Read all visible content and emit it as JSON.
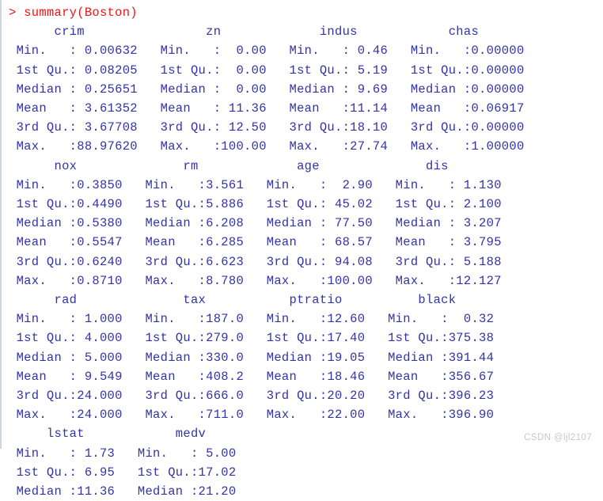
{
  "window": {
    "title": "R Console",
    "background_color": "#ffffff",
    "prompt_color": "#f01414",
    "output_color": "#3333aa",
    "watermark_color": "#c8c8c8"
  },
  "prompt": {
    "symbol": ">",
    "command": "summary(Boston)",
    "full_line": "> summary(Boston)"
  },
  "watermark": {
    "text": "CSDN @ljl2107"
  },
  "output_lines": [
    "      crim                zn             indus            chas        ",
    " Min.   : 0.00632   Min.   :  0.00   Min.   : 0.46   Min.   :0.00000  ",
    " 1st Qu.: 0.08205   1st Qu.:  0.00   1st Qu.: 5.19   1st Qu.:0.00000  ",
    " Median : 0.25651   Median :  0.00   Median : 9.69   Median :0.00000  ",
    " Mean   : 3.61352   Mean   : 11.36   Mean   :11.14   Mean   :0.06917  ",
    " 3rd Qu.: 3.67708   3rd Qu.: 12.50   3rd Qu.:18.10   3rd Qu.:0.00000  ",
    " Max.   :88.97620   Max.   :100.00   Max.   :27.74   Max.   :1.00000  ",
    "      nox              rm             age              dis        ",
    " Min.   :0.3850   Min.   :3.561   Min.   :  2.90   Min.   : 1.130  ",
    " 1st Qu.:0.4490   1st Qu.:5.886   1st Qu.: 45.02   1st Qu.: 2.100  ",
    " Median :0.5380   Median :6.208   Median : 77.50   Median : 3.207  ",
    " Mean   :0.5547   Mean   :6.285   Mean   : 68.57   Mean   : 3.795  ",
    " 3rd Qu.:0.6240   3rd Qu.:6.623   3rd Qu.: 94.08   3rd Qu.: 5.188  ",
    " Max.   :0.8710   Max.   :8.780   Max.   :100.00   Max.   :12.127  ",
    "      rad              tax           ptratio          black       ",
    " Min.   : 1.000   Min.   :187.0   Min.   :12.60   Min.   :  0.32  ",
    " 1st Qu.: 4.000   1st Qu.:279.0   1st Qu.:17.40   1st Qu.:375.38  ",
    " Median : 5.000   Median :330.0   Median :19.05   Median :391.44  ",
    " Mean   : 9.549   Mean   :408.2   Mean   :18.46   Mean   :356.67  ",
    " 3rd Qu.:24.000   3rd Qu.:666.0   3rd Qu.:20.20   3rd Qu.:396.23  ",
    " Max.   :24.000   Max.   :711.0   Max.   :22.00   Max.   :396.90  ",
    "     lstat            medv      ",
    " Min.   : 1.73   Min.   : 5.00  ",
    " 1st Qu.: 6.95   1st Qu.:17.02  ",
    " Median :11.36   Median :21.20  "
  ],
  "summary_table": {
    "type": "table",
    "function": "summary",
    "dataset": "Boston",
    "statistics": [
      "Min.",
      "1st Qu.",
      "Median",
      "Mean",
      "3rd Qu.",
      "Max."
    ],
    "variables": [
      {
        "name": "crim",
        "Min.": "0.00632",
        "1st Qu.": "0.08205",
        "Median": "0.25651",
        "Mean": "3.61352",
        "3rd Qu.": "3.67708",
        "Max.": "88.97620"
      },
      {
        "name": "zn",
        "Min.": "0.00",
        "1st Qu.": "0.00",
        "Median": "0.00",
        "Mean": "11.36",
        "3rd Qu.": "12.50",
        "Max.": "100.00"
      },
      {
        "name": "indus",
        "Min.": "0.46",
        "1st Qu.": "5.19",
        "Median": "9.69",
        "Mean": "11.14",
        "3rd Qu.": "18.10",
        "Max.": "27.74"
      },
      {
        "name": "chas",
        "Min.": "0.00000",
        "1st Qu.": "0.00000",
        "Median": "0.00000",
        "Mean": "0.06917",
        "3rd Qu.": "0.00000",
        "Max.": "1.00000"
      },
      {
        "name": "nox",
        "Min.": "0.3850",
        "1st Qu.": "0.4490",
        "Median": "0.5380",
        "Mean": "0.5547",
        "3rd Qu.": "0.6240",
        "Max.": "0.8710"
      },
      {
        "name": "rm",
        "Min.": "3.561",
        "1st Qu.": "5.886",
        "Median": "6.208",
        "Mean": "6.285",
        "3rd Qu.": "6.623",
        "Max.": "8.780"
      },
      {
        "name": "age",
        "Min.": "2.90",
        "1st Qu.": "45.02",
        "Median": "77.50",
        "Mean": "68.57",
        "3rd Qu.": "94.08",
        "Max.": "100.00"
      },
      {
        "name": "dis",
        "Min.": "1.130",
        "1st Qu.": "2.100",
        "Median": "3.207",
        "Mean": "3.795",
        "3rd Qu.": "5.188",
        "Max.": "12.127"
      },
      {
        "name": "rad",
        "Min.": "1.000",
        "1st Qu.": "4.000",
        "Median": "5.000",
        "Mean": "9.549",
        "3rd Qu.": "24.000",
        "Max.": "24.000"
      },
      {
        "name": "tax",
        "Min.": "187.0",
        "1st Qu.": "279.0",
        "Median": "330.0",
        "Mean": "408.2",
        "3rd Qu.": "666.0",
        "Max.": "711.0"
      },
      {
        "name": "ptratio",
        "Min.": "12.60",
        "1st Qu.": "17.40",
        "Median": "19.05",
        "Mean": "18.46",
        "3rd Qu.": "20.20",
        "Max.": "22.00"
      },
      {
        "name": "black",
        "Min.": "0.32",
        "1st Qu.": "375.38",
        "Median": "391.44",
        "Mean": "356.67",
        "3rd Qu.": "396.23",
        "Max.": "396.90"
      },
      {
        "name": "lstat",
        "Min.": "1.73",
        "1st Qu.": "6.95",
        "Median": "11.36",
        "Mean": "",
        "3rd Qu.": "",
        "Max.": ""
      },
      {
        "name": "medv",
        "Min.": "5.00",
        "1st Qu.": "17.02",
        "Median": "21.20",
        "Mean": "",
        "3rd Qu.": "",
        "Max.": ""
      }
    ]
  }
}
